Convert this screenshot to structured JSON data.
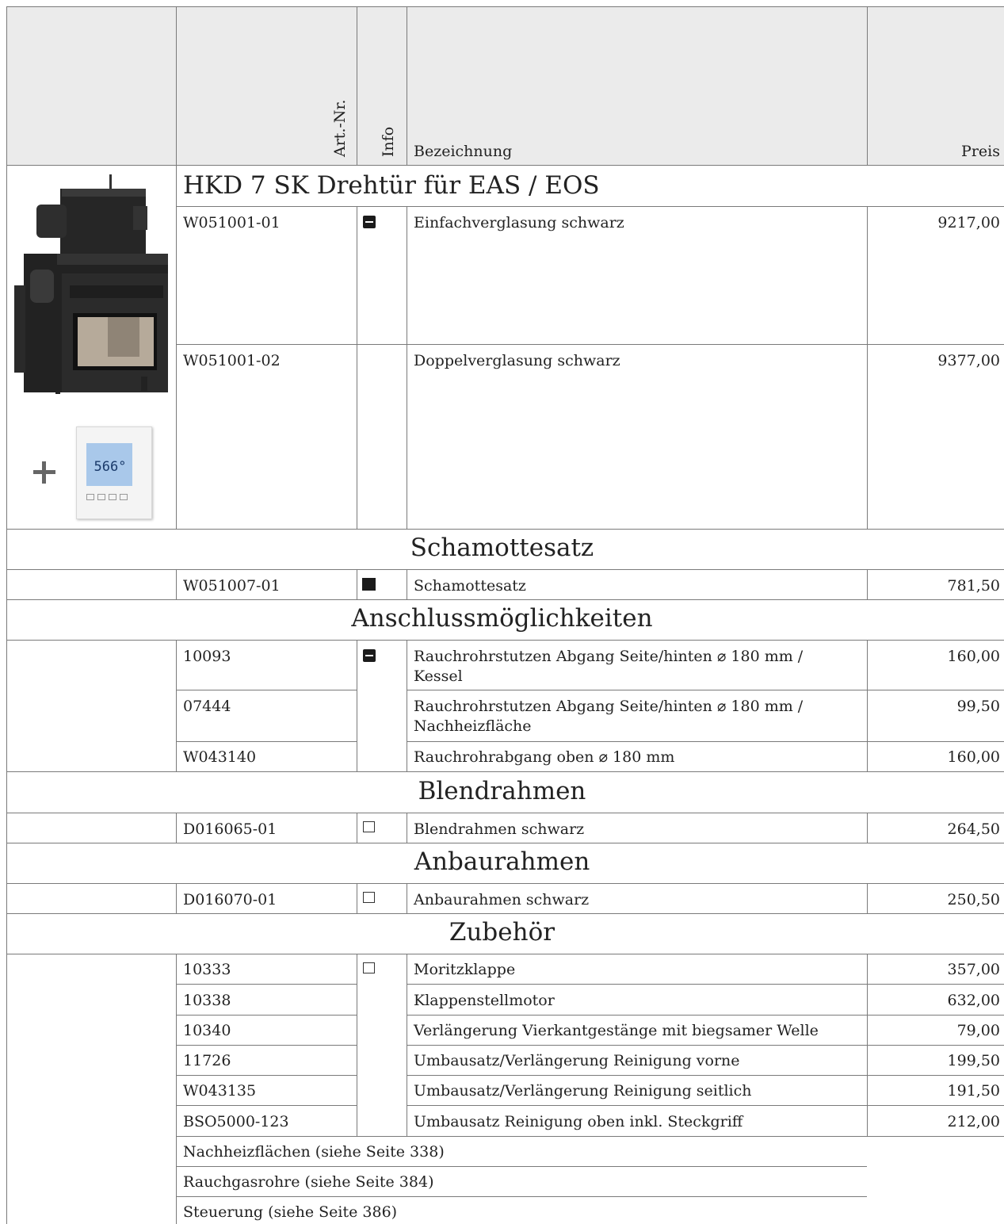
{
  "header": {
    "col_artnr": "Art.-Nr.",
    "col_info": "Info",
    "col_bezeichnung": "Bezeichnung",
    "col_preis": "Preis"
  },
  "product": {
    "title": "HKD 7 SK Drehtür für EAS / EOS",
    "thermostat_display": "566°",
    "rows": [
      {
        "artnr": "W051001-01",
        "desc": "Einfachverglasung schwarz",
        "price": "9217,00"
      },
      {
        "artnr": "W051001-02",
        "desc": "Doppelverglasung schwarz",
        "price": "9377,00"
      }
    ]
  },
  "schamotte": {
    "title": "Schamottesatz",
    "rows": [
      {
        "artnr": "W051007-01",
        "desc": "Schamottesatz",
        "price": "781,50"
      }
    ]
  },
  "anschluss": {
    "title": "Anschlussmöglichkeiten",
    "rows": [
      {
        "artnr": "10093",
        "desc1": "Rauchrohrstutzen Abgang Seite/hinten ⌀ 180 mm /",
        "desc2": "Kessel",
        "price": "160,00"
      },
      {
        "artnr": "07444",
        "desc1": "Rauchrohrstutzen Abgang Seite/hinten ⌀ 180 mm /",
        "desc2": "Nachheizfläche",
        "price": "99,50"
      },
      {
        "artnr": "W043140",
        "desc1": "Rauchrohrabgang oben ⌀ 180 mm",
        "price": "160,00"
      }
    ]
  },
  "blend": {
    "title": "Blendrahmen",
    "rows": [
      {
        "artnr": "D016065-01",
        "desc": "Blendrahmen schwarz",
        "price": "264,50"
      }
    ]
  },
  "anbau": {
    "title": "Anbaurahmen",
    "rows": [
      {
        "artnr": "D016070-01",
        "desc": "Anbaurahmen schwarz",
        "price": "250,50"
      }
    ]
  },
  "zubehoer": {
    "title": "Zubehör",
    "rows": [
      {
        "artnr": "10333",
        "desc": "Moritzklappe",
        "price": "357,00"
      },
      {
        "artnr": "10338",
        "desc": "Klappenstellmotor",
        "price": "632,00"
      },
      {
        "artnr": "10340",
        "desc": "Verlängerung Vierkantgestänge mit biegsamer Welle",
        "price": "79,00"
      },
      {
        "artnr": "11726",
        "desc": "Umbausatz/Verlängerung Reinigung vorne",
        "price": "199,50"
      },
      {
        "artnr": "W043135",
        "desc": "Umbausatz/Verlängerung Reinigung seitlich",
        "price": "191,50"
      },
      {
        "artnr": "BSO5000-123",
        "desc": "Umbausatz Reinigung oben inkl. Steckgriff",
        "price": "212,00"
      }
    ],
    "notes": [
      "Nachheizflächen (siehe Seite 338)",
      "Rauchgasrohre (siehe Seite 384)",
      "Steuerung (siehe Seite 386)"
    ]
  },
  "icons": {
    "info_dark": "minus-box-icon",
    "info_solid": "filled-square-icon",
    "info_empty": "empty-square-icon"
  }
}
